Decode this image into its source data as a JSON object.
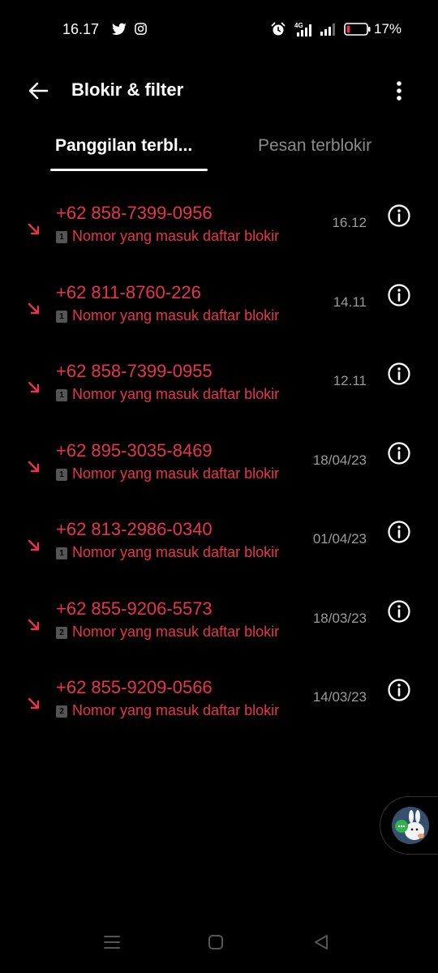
{
  "status_bar": {
    "time": "16.17",
    "battery_percent": "17%",
    "battery_level": 0.17,
    "network_label": "4G"
  },
  "header": {
    "title": "Blokir & filter"
  },
  "tabs": [
    {
      "label": "Panggilan terbl...",
      "active": true
    },
    {
      "label": "Pesan terblokir",
      "active": false
    }
  ],
  "calls": [
    {
      "number": "+62 858-7399-0956",
      "sim": "1",
      "reason": "Nomor yang masuk daftar blokir",
      "time": "16.12"
    },
    {
      "number": "+62 811-8760-226",
      "sim": "1",
      "reason": "Nomor yang masuk daftar blokir",
      "time": "14.11"
    },
    {
      "number": "+62 858-7399-0955",
      "sim": "1",
      "reason": "Nomor yang masuk daftar blokir",
      "time": "12.11"
    },
    {
      "number": "+62 895-3035-8469",
      "sim": "1",
      "reason": "Nomor yang masuk daftar blokir",
      "time": "18/04/23"
    },
    {
      "number": "+62 813-2986-0340",
      "sim": "1",
      "reason": "Nomor yang masuk daftar blokir",
      "time": "01/04/23"
    },
    {
      "number": "+62 855-9206-5573",
      "sim": "2",
      "reason": "Nomor yang masuk daftar blokir",
      "time": "18/03/23"
    },
    {
      "number": "+62 855-9209-0566",
      "sim": "2",
      "reason": "Nomor yang masuk daftar blokir",
      "time": "14/03/23"
    }
  ],
  "colors": {
    "accent_red": "#e8344e",
    "background": "#000000",
    "secondary_text": "#9b9b9b"
  },
  "icons": {
    "back": "arrow-left-icon",
    "menu": "more-vertical-icon",
    "call_type": "incoming-call-arrow-icon",
    "info": "info-circle-icon"
  }
}
